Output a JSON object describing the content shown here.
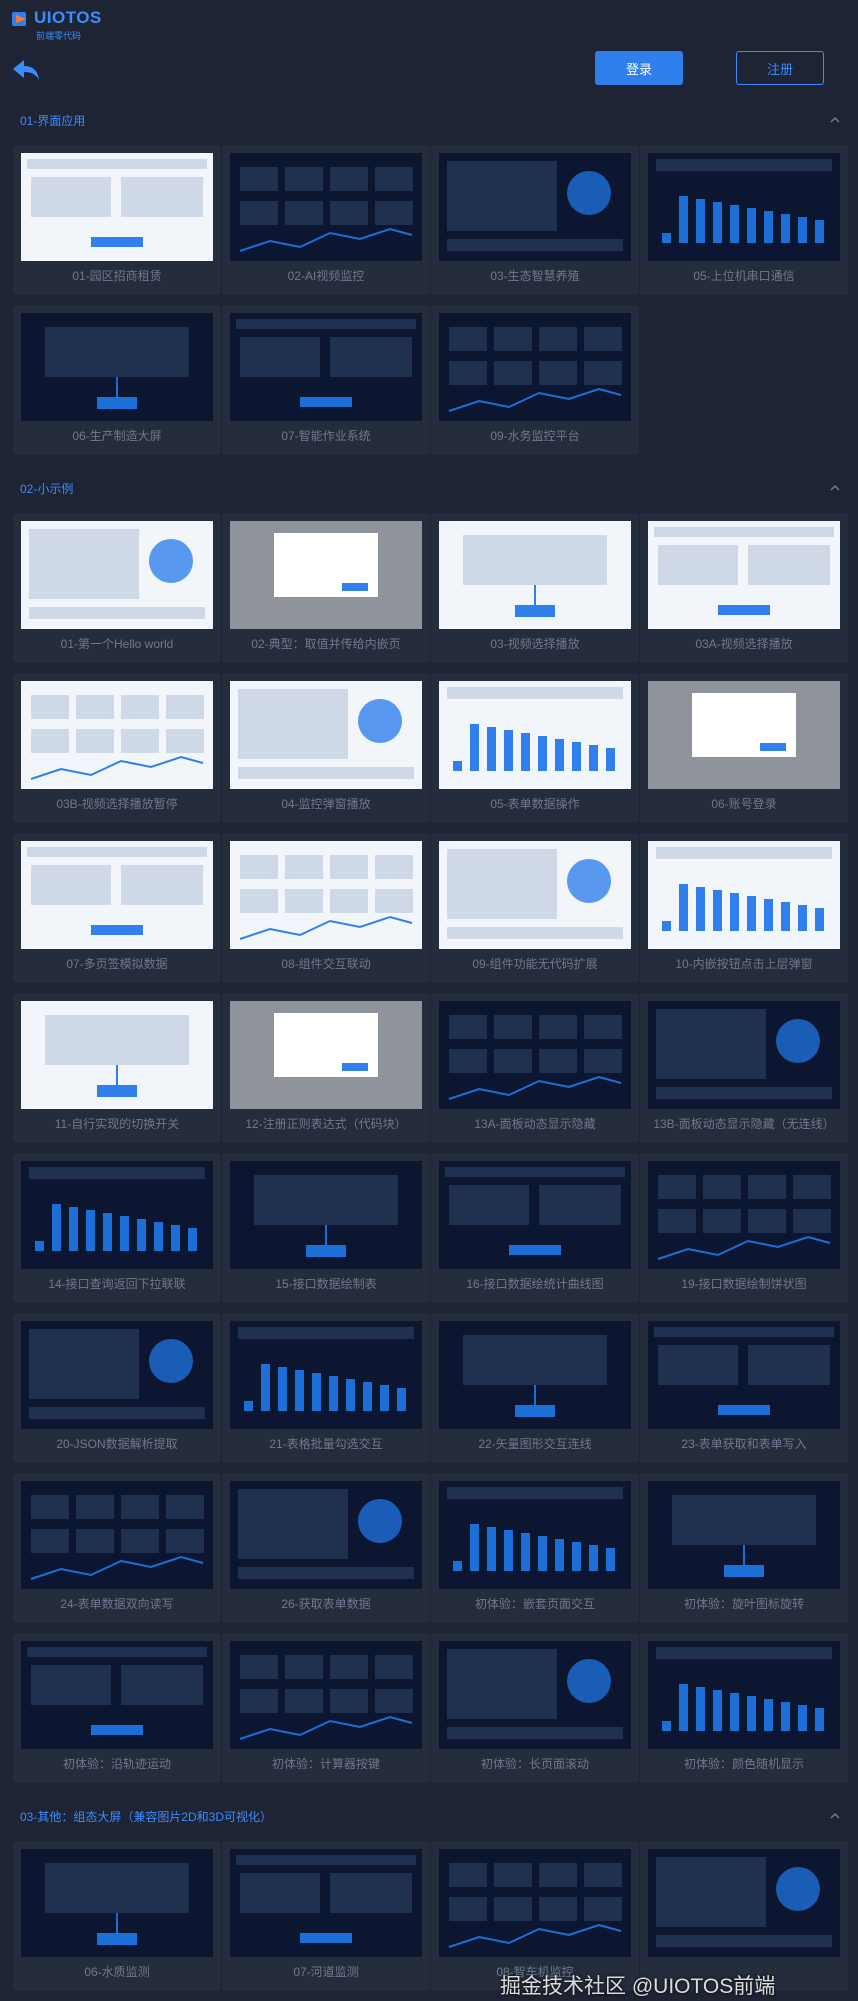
{
  "brand": {
    "name": "UIOTOS",
    "tagline": "前端零代码"
  },
  "header": {
    "login_label": "登录",
    "register_label": "注册"
  },
  "sections": [
    {
      "title": "01-界面应用",
      "cards": [
        {
          "label": "01-园区招商租赁",
          "theme": "light"
        },
        {
          "label": "02-AI视频监控",
          "theme": "dark"
        },
        {
          "label": "03-生态智慧养殖",
          "theme": "dark"
        },
        {
          "label": "05-上位机串口通信",
          "theme": "dark"
        },
        {
          "label": "06-生产制造大屏",
          "theme": "dark"
        },
        {
          "label": "07-智能作业系统",
          "theme": "dark"
        },
        {
          "label": "09-水务监控平台",
          "theme": "dark"
        }
      ]
    },
    {
      "title": "02-小示例",
      "cards": [
        {
          "label": "01-第一个Hello world",
          "theme": "light"
        },
        {
          "label": "02-典型：取值并传给内嵌页",
          "theme": "gray"
        },
        {
          "label": "03-视频选择播放",
          "theme": "light"
        },
        {
          "label": "03A-视频选择播放",
          "theme": "light"
        },
        {
          "label": "03B-视频选择播放暂停",
          "theme": "light"
        },
        {
          "label": "04-监控弹窗播放",
          "theme": "light"
        },
        {
          "label": "05-表单数据操作",
          "theme": "light"
        },
        {
          "label": "06-账号登录",
          "theme": "gray"
        },
        {
          "label": "07-多页签模拟数据",
          "theme": "light"
        },
        {
          "label": "08-组件交互联动",
          "theme": "light"
        },
        {
          "label": "09-组件功能无代码扩展",
          "theme": "light"
        },
        {
          "label": "10-内嵌按钮点击上层弹窗",
          "theme": "light"
        },
        {
          "label": "11-自行实现的切换开关",
          "theme": "light"
        },
        {
          "label": "12-注册正则表达式（代码块）",
          "theme": "gray"
        },
        {
          "label": "13A-面板动态显示隐藏",
          "theme": "dark"
        },
        {
          "label": "13B-面板动态显示隐藏（无连线）",
          "theme": "dark"
        },
        {
          "label": "14-接口查询返回下拉联联",
          "theme": "dark"
        },
        {
          "label": "15-接口数据绘制表",
          "theme": "dark"
        },
        {
          "label": "16-接口数据绘统计曲线图",
          "theme": "dark"
        },
        {
          "label": "19-接口数据绘制饼状图",
          "theme": "dark"
        },
        {
          "label": "20-JSON数据解析提取",
          "theme": "dark"
        },
        {
          "label": "21-表格批量勾选交互",
          "theme": "dark"
        },
        {
          "label": "22-矢量图形交互连线",
          "theme": "dark"
        },
        {
          "label": "23-表单获取和表单写入",
          "theme": "dark"
        },
        {
          "label": "24-表单数据双向读写",
          "theme": "dark"
        },
        {
          "label": "26-获取表单数据",
          "theme": "dark"
        },
        {
          "label": "初体验：嵌套页面交互",
          "theme": "dark"
        },
        {
          "label": "初体验：旋叶图标旋转",
          "theme": "dark"
        },
        {
          "label": "初体验：沿轨迹运动",
          "theme": "dark"
        },
        {
          "label": "初体验：计算器按键",
          "theme": "dark"
        },
        {
          "label": "初体验：长页面滚动",
          "theme": "dark"
        },
        {
          "label": "初体验：颜色随机显示",
          "theme": "dark"
        }
      ]
    },
    {
      "title": "03-其他：组态大屏（兼容图片2D和3D可视化）",
      "cards": [
        {
          "label": "06-水质监测",
          "theme": "dark"
        },
        {
          "label": "07-河道监测",
          "theme": "dark"
        },
        {
          "label": "08-智车机监控",
          "theme": "dark"
        },
        {
          "label": "",
          "theme": "dark"
        }
      ]
    }
  ],
  "watermark": "掘金技术社区 @UIOTOS前端"
}
